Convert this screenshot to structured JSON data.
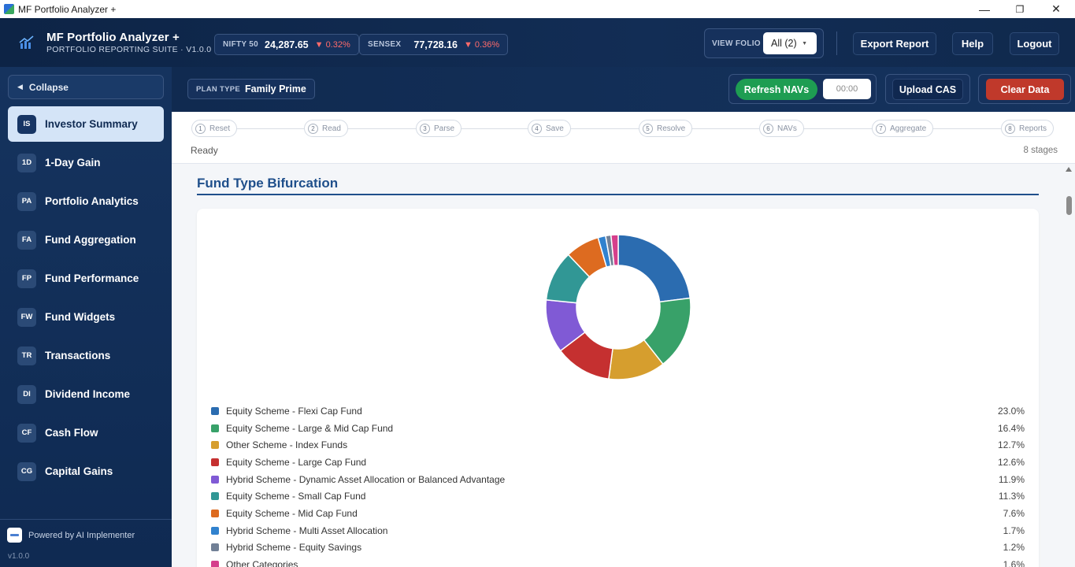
{
  "window": {
    "title": "MF Portfolio Analyzer +",
    "minimize": "—",
    "maximize": "❐",
    "close": "✕"
  },
  "header": {
    "brand_title": "MF Portfolio Analyzer +",
    "brand_subtitle": "PORTFOLIO REPORTING SUITE · V1.0.0",
    "tickers": [
      {
        "label": "NIFTY 50",
        "value": "24,287.65",
        "change": "▼ 0.32%"
      },
      {
        "label": "SENSEX",
        "value": "77,728.16",
        "change": "▼ 0.36%"
      }
    ],
    "folio_label": "VIEW FOLIO",
    "folio_value": "All (2)",
    "folio_caret": "▼",
    "export_label": "Export Report",
    "help_label": "Help",
    "logout_label": "Logout"
  },
  "sidebar": {
    "collapse_label": "Collapse",
    "collapse_arrow": "◀",
    "items": [
      {
        "code": "IS",
        "label": "Investor Summary",
        "active": true
      },
      {
        "code": "1D",
        "label": "1-Day Gain"
      },
      {
        "code": "PA",
        "label": "Portfolio Analytics"
      },
      {
        "code": "FA",
        "label": "Fund Aggregation"
      },
      {
        "code": "FP",
        "label": "Fund Performance"
      },
      {
        "code": "FW",
        "label": "Fund Widgets"
      },
      {
        "code": "TR",
        "label": "Transactions"
      },
      {
        "code": "DI",
        "label": "Dividend Income"
      },
      {
        "code": "CF",
        "label": "Cash Flow"
      },
      {
        "code": "CG",
        "label": "Capital Gains"
      }
    ],
    "powered_by": "Powered by AI Implementer",
    "version": "v1.0.0"
  },
  "toolbar": {
    "plan_label": "PLAN TYPE",
    "plan_value": "Family Prime",
    "refresh_label": "Refresh NAVs",
    "timer": "00:00",
    "upload_label": "Upload CAS",
    "clear_label": "Clear Data"
  },
  "stages": {
    "items": [
      {
        "num": "1",
        "label": "Reset"
      },
      {
        "num": "2",
        "label": "Read"
      },
      {
        "num": "3",
        "label": "Parse"
      },
      {
        "num": "4",
        "label": "Save"
      },
      {
        "num": "5",
        "label": "Resolve"
      },
      {
        "num": "6",
        "label": "NAVs"
      },
      {
        "num": "7",
        "label": "Aggregate"
      },
      {
        "num": "8",
        "label": "Reports"
      }
    ],
    "status": "Ready",
    "count_text": "8 stages"
  },
  "section": {
    "title": "Fund Type Bifurcation"
  },
  "chart_data": {
    "type": "pie",
    "title": "Fund Type Bifurcation",
    "donut": true,
    "legend_position": "bottom",
    "categories": [
      "Equity Scheme - Flexi Cap Fund",
      "Equity Scheme - Large & Mid Cap Fund",
      "Other Scheme - Index Funds",
      "Equity Scheme - Large Cap Fund",
      "Hybrid Scheme - Dynamic Asset Allocation or Balanced Advantage",
      "Equity Scheme - Small Cap Fund",
      "Equity Scheme - Mid Cap Fund",
      "Hybrid Scheme - Multi Asset Allocation",
      "Hybrid Scheme - Equity Savings",
      "Other Categories"
    ],
    "values": [
      23.0,
      16.4,
      12.7,
      12.6,
      11.9,
      11.3,
      7.6,
      1.7,
      1.2,
      1.6
    ],
    "labels": [
      "23.0%",
      "16.4%",
      "12.7%",
      "12.6%",
      "11.9%",
      "11.3%",
      "7.6%",
      "1.7%",
      "1.2%",
      "1.6%"
    ],
    "colors": [
      "#2b6cb0",
      "#38a169",
      "#d69e2e",
      "#c53030",
      "#805ad5",
      "#319795",
      "#dd6b20",
      "#3182ce",
      "#718096",
      "#d53f8c"
    ]
  }
}
